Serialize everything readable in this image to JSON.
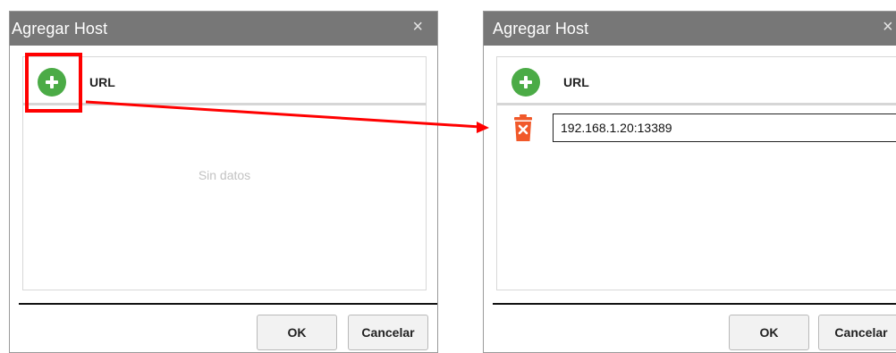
{
  "dialog_left": {
    "title": "Agregar Host",
    "close_glyph": "×",
    "column_header": "URL",
    "empty_message": "Sin datos",
    "ok_label": "OK",
    "cancel_label": "Cancelar"
  },
  "dialog_right": {
    "title": "Agregar Host",
    "close_glyph": "×",
    "column_header": "URL",
    "rows": [
      {
        "url": "192.168.1.20:13389"
      }
    ],
    "ok_label": "OK",
    "cancel_label": "Cancelar"
  },
  "icons": {
    "add": "plus-circle-icon",
    "delete": "trash-icon",
    "close": "close-icon"
  },
  "colors": {
    "titlebar": "#777777",
    "add_icon": "#4bab46",
    "delete_icon": "#f1592a",
    "annotation": "#ff0000"
  }
}
